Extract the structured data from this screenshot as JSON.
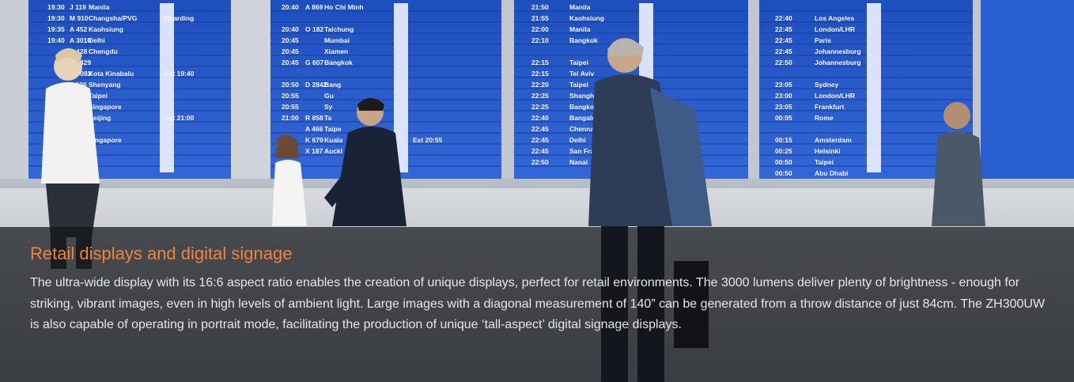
{
  "caption": {
    "title": "Retail displays and digital signage",
    "body": "The ultra-wide display with its 16:6 aspect ratio enables the creation of unique displays, perfect for retail environments. The 3000 lumens deliver plenty of brightness - enough for striking, vibrant images, even in high levels of ambient light. Large images with a diagonal measurement of 140” can be generated from a throw distance of just 84cm. The ZH300UW is also capable of operating in portrait mode, facilitating the production of unique ‘tall-aspect’ digital signage displays."
  },
  "boards": [
    {
      "rows": [
        {
          "time": "19:30",
          "flight": "J 119",
          "dest": "Manila",
          "status": ""
        },
        {
          "time": "19:30",
          "flight": "M 910",
          "dest": "Changsha/PVG",
          "status": "Boarding"
        },
        {
          "time": "19:35",
          "flight": "A 452",
          "dest": "Kaohsiung",
          "status": ""
        },
        {
          "time": "19:40",
          "flight": "A 3010",
          "dest": "Delhi",
          "status": ""
        },
        {
          "time": "",
          "flight": "A 428",
          "dest": "Chengdu",
          "status": ""
        },
        {
          "time": "",
          "flight": "A 1429",
          "dest": "",
          "status": ""
        },
        {
          "time": "",
          "flight": "K 0083",
          "dest": "Kota Kinabalu",
          "status": "Est 19:40"
        },
        {
          "time": "",
          "flight": "Z 636",
          "dest": "Shenyang",
          "status": ""
        },
        {
          "time": "19",
          "flight": "468",
          "dest": "Taipei",
          "status": ""
        },
        {
          "time": "",
          "flight": "",
          "dest": "Singapore",
          "status": ""
        },
        {
          "time": "",
          "flight": "",
          "dest": "Beijing",
          "status": "Est 21:00"
        },
        {
          "time": "",
          "flight": "",
          "dest": "",
          "status": ""
        },
        {
          "time": "",
          "flight": "",
          "dest": "Singapore",
          "status": ""
        }
      ]
    },
    {
      "rows": [
        {
          "time": "20:40",
          "flight": "A 869",
          "dest": "Ho Chi Minh",
          "status": ""
        },
        {
          "time": "",
          "flight": "",
          "dest": "",
          "status": ""
        },
        {
          "time": "20:40",
          "flight": "O 182",
          "dest": "Taichung",
          "status": ""
        },
        {
          "time": "20:45",
          "flight": "",
          "dest": "Mumbai",
          "status": ""
        },
        {
          "time": "20:45",
          "flight": "",
          "dest": "Xiamen",
          "status": ""
        },
        {
          "time": "20:45",
          "flight": "G 607",
          "dest": "Bangkok",
          "status": ""
        },
        {
          "time": "",
          "flight": "",
          "dest": "",
          "status": ""
        },
        {
          "time": "20:50",
          "flight": "D 2842",
          "dest": "Bang",
          "status": ""
        },
        {
          "time": "20:55",
          "flight": "",
          "dest": "Gu",
          "status": ""
        },
        {
          "time": "20:55",
          "flight": "",
          "dest": "Sy",
          "status": ""
        },
        {
          "time": "21:00",
          "flight": "R 858",
          "dest": "Ta",
          "status": ""
        },
        {
          "time": "",
          "flight": "A 466",
          "dest": "Taipe",
          "status": ""
        },
        {
          "time": "",
          "flight": "K 679",
          "dest": "Kuala",
          "status": "Est 20:55"
        },
        {
          "time": "",
          "flight": "X 187",
          "dest": "Auckl",
          "status": ""
        }
      ]
    },
    {
      "rows": [
        {
          "time": "21:50",
          "flight": "",
          "dest": "Manila",
          "status": ""
        },
        {
          "time": "21:55",
          "flight": "",
          "dest": "Kaohsiung",
          "status": ""
        },
        {
          "time": "22:00",
          "flight": "",
          "dest": "Manila",
          "status": ""
        },
        {
          "time": "22:10",
          "flight": "",
          "dest": "Bangkok",
          "status": ""
        },
        {
          "time": "",
          "flight": "",
          "dest": "",
          "status": ""
        },
        {
          "time": "22:15",
          "flight": "",
          "dest": "Taipei",
          "status": ""
        },
        {
          "time": "22:15",
          "flight": "",
          "dest": "Tel Aviv",
          "status": ""
        },
        {
          "time": "22:20",
          "flight": "",
          "dest": "Taipei",
          "status": ""
        },
        {
          "time": "22:25",
          "flight": "",
          "dest": "Shanghai",
          "status": ""
        },
        {
          "time": "22:25",
          "flight": "",
          "dest": "Bangkok",
          "status": ""
        },
        {
          "time": "22:40",
          "flight": "",
          "dest": "Bangalore",
          "status": ""
        },
        {
          "time": "22:45",
          "flight": "",
          "dest": "Chennai",
          "status": ""
        },
        {
          "time": "22:45",
          "flight": "",
          "dest": "Delhi",
          "status": ""
        },
        {
          "time": "22:45",
          "flight": "",
          "dest": "San Franc",
          "status": ""
        },
        {
          "time": "22:50",
          "flight": "",
          "dest": "Nanai",
          "status": ""
        }
      ]
    },
    {
      "rows": [
        {
          "time": "",
          "flight": "",
          "dest": "",
          "status": ""
        },
        {
          "time": "22:40",
          "flight": "",
          "dest": "Los Angeles",
          "status": ""
        },
        {
          "time": "22:45",
          "flight": "",
          "dest": "London/LHR",
          "status": ""
        },
        {
          "time": "22:45",
          "flight": "",
          "dest": "Paris",
          "status": ""
        },
        {
          "time": "22:45",
          "flight": "",
          "dest": "Johannesburg",
          "status": ""
        },
        {
          "time": "22:50",
          "flight": "",
          "dest": "Johannesburg",
          "status": ""
        },
        {
          "time": "",
          "flight": "",
          "dest": "",
          "status": ""
        },
        {
          "time": "23:05",
          "flight": "",
          "dest": "Sydney",
          "status": ""
        },
        {
          "time": "23:00",
          "flight": "",
          "dest": "London/LHR",
          "status": ""
        },
        {
          "time": "23:05",
          "flight": "",
          "dest": "Frankfurt",
          "status": ""
        },
        {
          "time": "00:05",
          "flight": "",
          "dest": "Rome",
          "status": ""
        },
        {
          "time": "",
          "flight": "",
          "dest": "",
          "status": ""
        },
        {
          "time": "00:15",
          "flight": "",
          "dest": "Amsterdam",
          "status": ""
        },
        {
          "time": "00:25",
          "flight": "",
          "dest": "Helsinki",
          "status": ""
        },
        {
          "time": "00:50",
          "flight": "",
          "dest": "Taipei",
          "status": ""
        },
        {
          "time": "00:50",
          "flight": "",
          "dest": "Abu Dhabi",
          "status": ""
        }
      ]
    }
  ],
  "colors": {
    "title": "#f0843a",
    "body_text": "#e6e6e6",
    "caption_band": "#14161a",
    "board_blue": "#2a58c8",
    "floor": "#c9ccd2"
  }
}
